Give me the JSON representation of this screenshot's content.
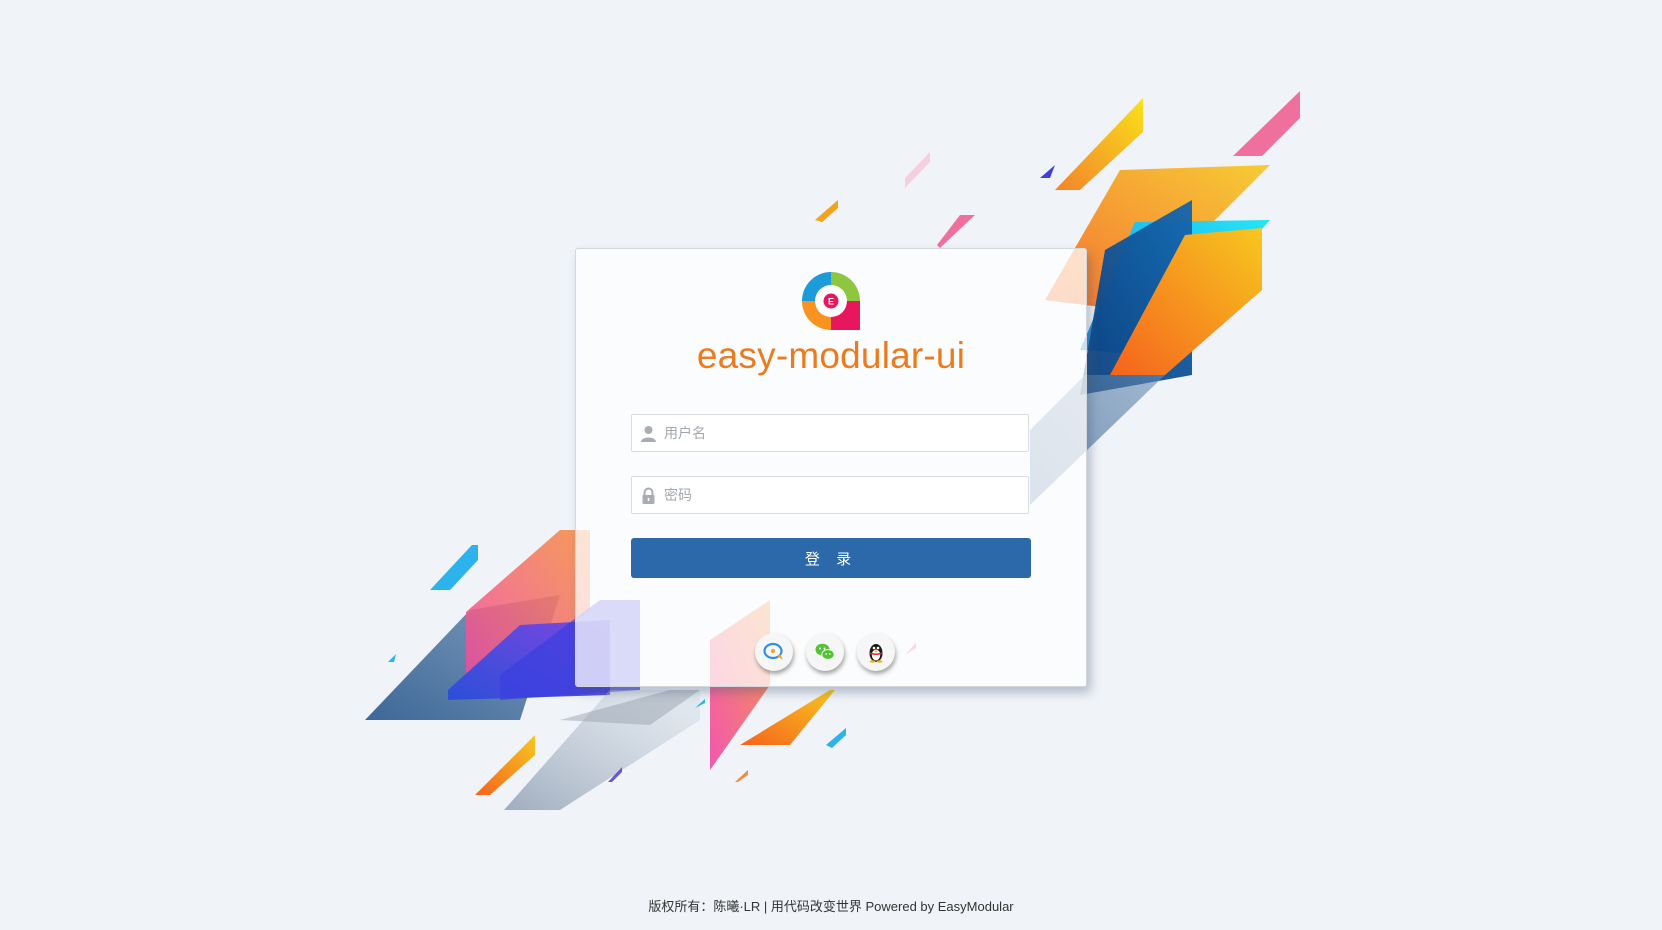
{
  "app": {
    "title": "easy-modular-ui",
    "logo_icon": "easy-modular-logo-icon",
    "logo_letter": "E"
  },
  "login": {
    "username_placeholder": "用户名",
    "username_value": "",
    "password_placeholder": "密码",
    "password_value": "",
    "submit_label": "登 录"
  },
  "social_login": [
    {
      "icon": "chat-bubble-icon"
    },
    {
      "icon": "wechat-icon"
    },
    {
      "icon": "qq-penguin-icon"
    }
  ],
  "footer": {
    "text": "版权所有：陈曦·LR | 用代码改变世界 Powered by EasyModular"
  },
  "colors": {
    "page_background": "#f0f4f8",
    "title_orange": "#ec7a1e",
    "button_blue": "#2b69ab"
  }
}
